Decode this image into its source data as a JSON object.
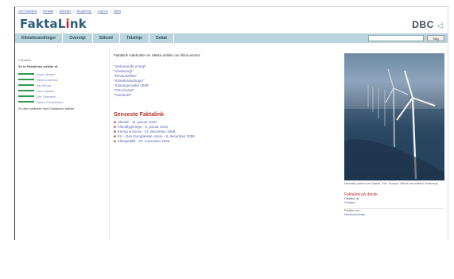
{
  "topbar": {
    "links": [
      "Om Faktalink",
      "Kontakt",
      "Nyheder",
      "Brugervejl.",
      "Log ind",
      "Hjem"
    ]
  },
  "header": {
    "logo_main": "FaktaL",
    "logo_accent": "i",
    "logo_end": "nk",
    "dbc_label": "DBC",
    "dbc_mark": "◁"
  },
  "nav": {
    "tabs": [
      "Klimaforandringer",
      "Oversigt",
      "Stikord",
      "Tidslinje",
      "Debat"
    ],
    "search_placeholder": "",
    "search_button": "Søg"
  },
  "sidebar": {
    "heading": "Faktalink",
    "subheading": "Se in Faktalinks artikler af",
    "authors": [
      "Anne Jensen",
      "Helle Andersen",
      "Jan Bruun",
      "Lars Carlsen",
      "Ole Thomsen",
      "Søren Christensen"
    ],
    "footer": "Se alle forfattere med Faktalinks artikler"
  },
  "main": {
    "intro": "Faktalink indeholder en række artikler om klima emner:",
    "topic_links": [
      "\"Vedvarende energi\"",
      "\"Vindenergi\"",
      "\"Drivhuseffekt\"",
      "\"Klimaforandringer\"",
      "\"Klimatopmødet 2009\"",
      "\"CO2-kvoter\"",
      "\"Atomkraft\""
    ],
    "news_heading": "Senseste Faktalink",
    "news": [
      "Ulande - 11. januar 2010",
      "Klimaflygtninge - 6. januar 2010",
      "Energi & Klima - 13. december 2009",
      "EU - Den Europæiske Union - 8. december 2009",
      "Klimapolitik - 27. november 2009"
    ]
  },
  "right": {
    "photo_alt": "Havvindmøller",
    "caption": "Havmølle-parken ved Nysted. Foto: Scanpix. Billede ved artiklen Vindenergi.",
    "box_heading": "Faktalink på dansk",
    "box_text": "Faktalink.dk",
    "box_link": "Faktalink",
    "section2": "Portalen om",
    "section2_link": "klimaforandringer"
  }
}
